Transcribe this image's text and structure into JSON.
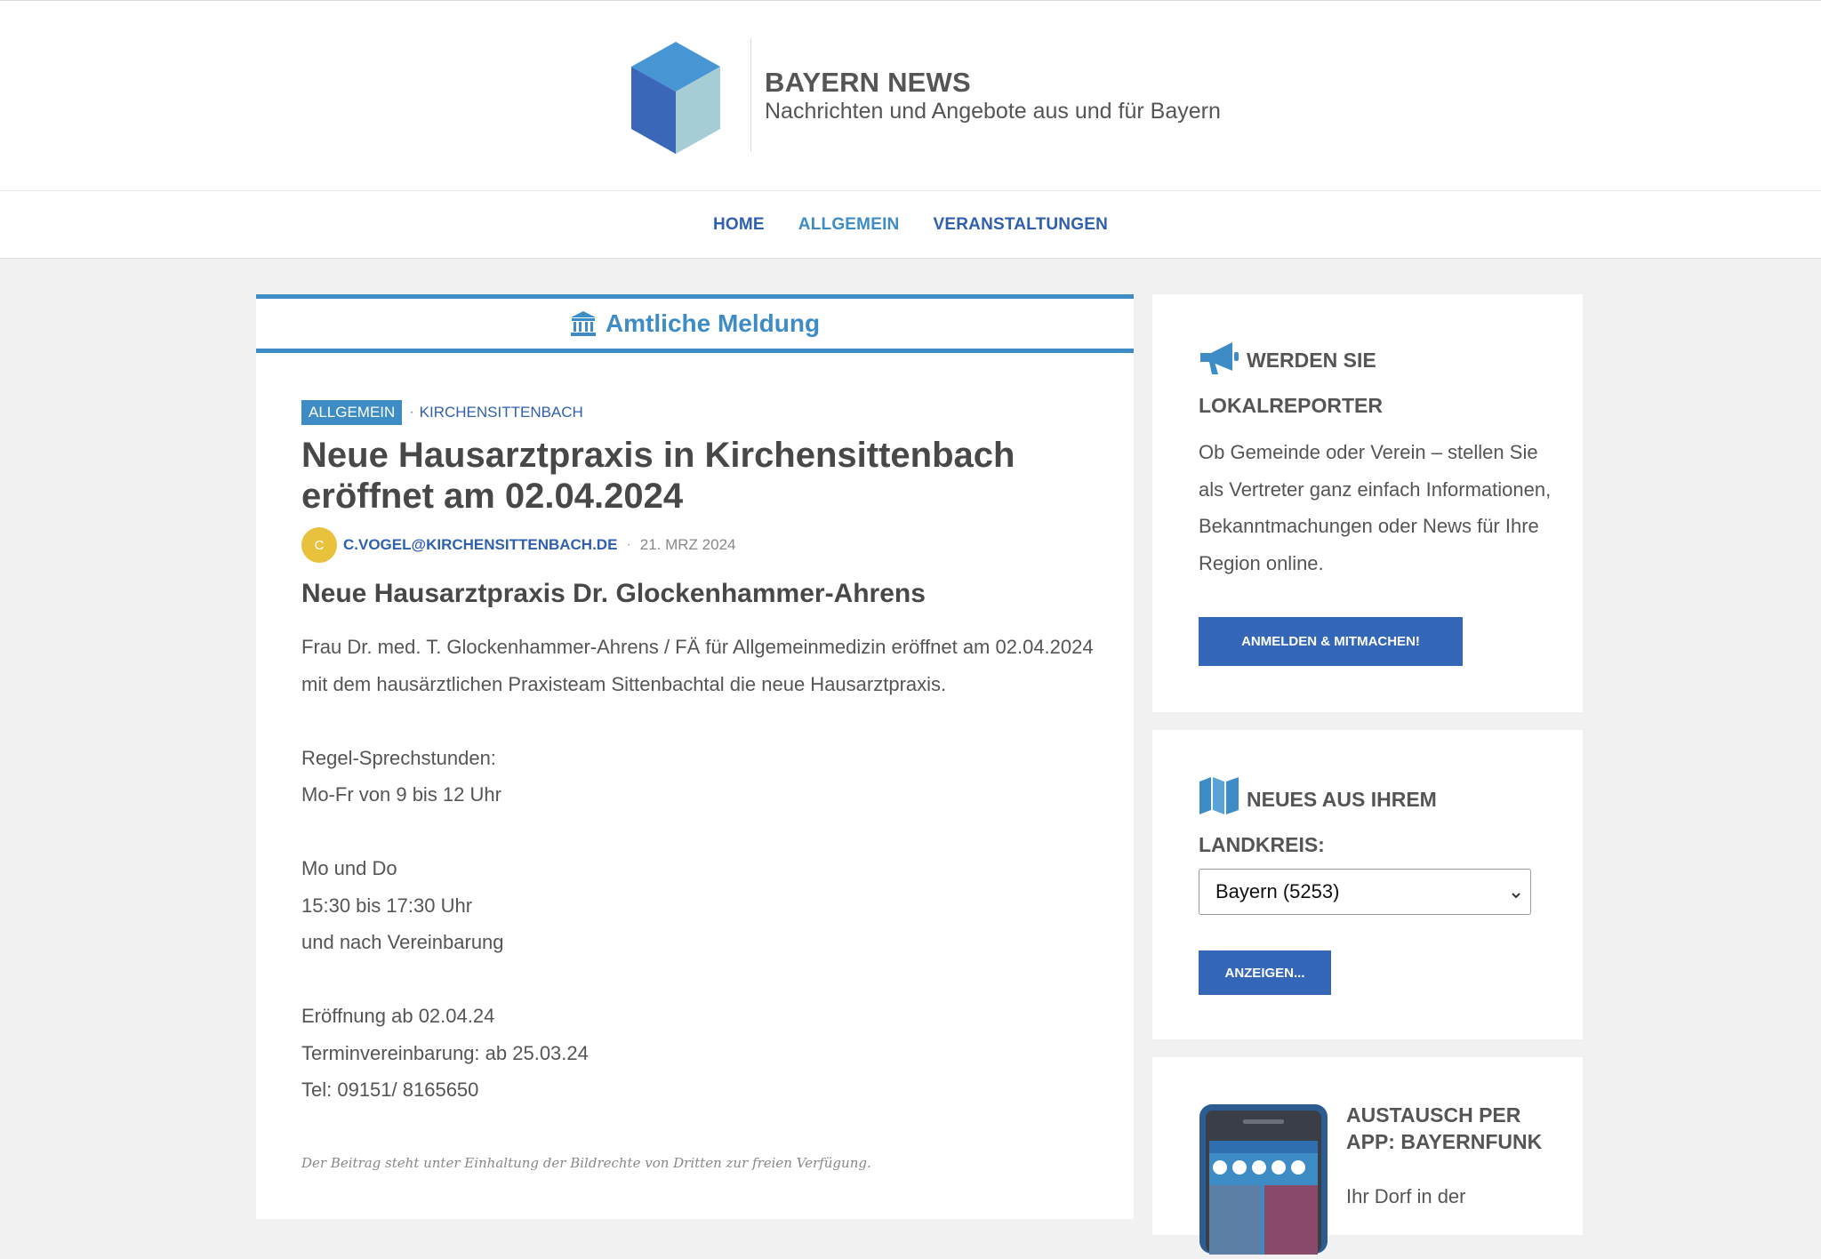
{
  "site": {
    "title": "BAYERN NEWS",
    "tagline": "Nachrichten und Angebote aus und für Bayern",
    "colors": {
      "accent": "#3d8cc6",
      "link": "#2f5fae",
      "button": "#3467b8",
      "avatar": "#e9c23d"
    }
  },
  "nav": {
    "items": [
      "HOME",
      "ALLGEMEIN",
      "VERANSTALTUNGEN"
    ],
    "active": "ALLGEMEIN"
  },
  "article": {
    "banner": "Amtliche Meldung",
    "banner_icon": "government-building-icon",
    "category": "ALLGEMEIN",
    "location": "KIRCHENSITTENBACH",
    "title": "Neue Hausarztpraxis in Kirchensittenbach eröffnet am 02.04.2024",
    "avatar_letter": "C",
    "author": "C.VOGEL@KIRCHENSITTENBACH.DE",
    "date": "21. MRZ 2024",
    "subheading": "Neue Hausarztpraxis Dr. Glockenhammer-Ahrens",
    "paragraphs": {
      "p1": "Frau Dr. med. T. Glockenhammer-Ahrens / FÄ für Allgemeinmedizin eröffnet am 02.04.2024 mit dem hausärztlichen Praxisteam Sittenbachtal die neue Hausarztpraxis.",
      "hours_label": "Regel-Sprechstunden:",
      "hours_1": "Mo-Fr von 9 bis 12 Uhr",
      "hours_2_day": "Mo und Do",
      "hours_2_time": "15:30 bis 17:30 Uhr",
      "hours_2_note": "und nach Vereinbarung",
      "opening": "Eröffnung ab 02.04.24",
      "appointment": "Terminvereinbarung: ab 25.03.24",
      "phone": "Tel: 09151/ 8165650"
    },
    "footnote": "Der Beitrag steht unter Einhaltung der Bildrechte von Dritten zur freien Verfügung."
  },
  "sidebar": {
    "reporter": {
      "icon": "megaphone-icon",
      "title": "WERDEN SIE LOKALREPORTER",
      "text": "Ob Gemeinde oder Verein – stellen Sie als Vertreter ganz einfach Informationen, Bekanntmachungen oder News für Ihre Region online.",
      "button": "ANMELDEN & MITMACHEN!"
    },
    "district": {
      "icon": "map-icon",
      "title": "NEUES AUS IHREM LANDKREIS:",
      "selected": "Bayern (5253)",
      "button": "ANZEIGEN..."
    },
    "app": {
      "title": "AUSTAUSCH PER APP: BAYERNFUNK",
      "text": "Ihr Dorf in der"
    }
  }
}
